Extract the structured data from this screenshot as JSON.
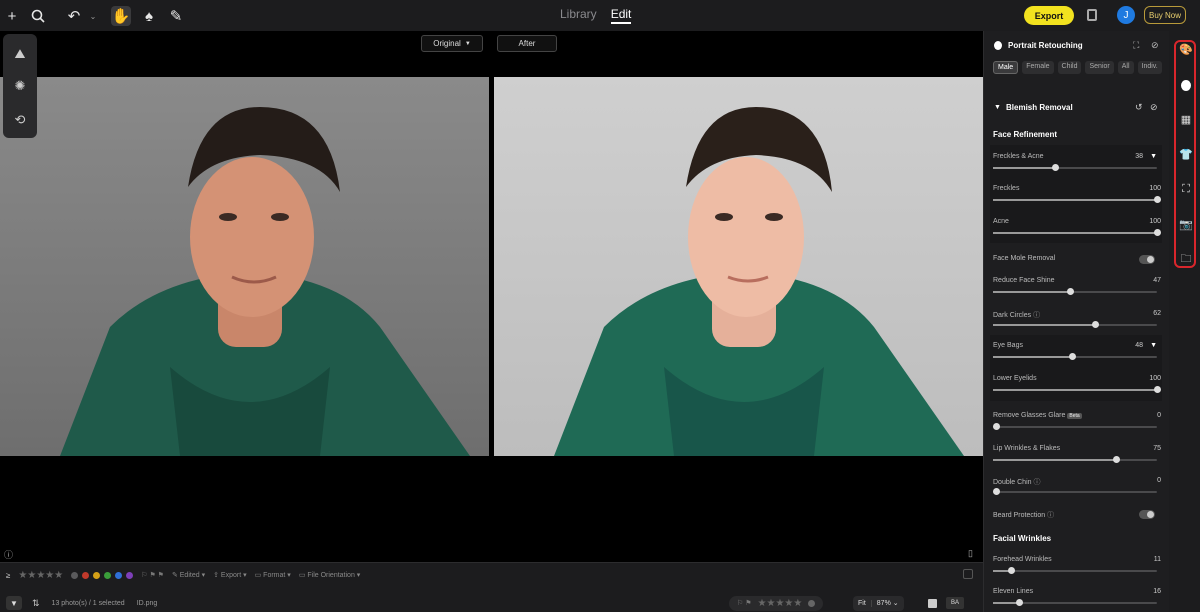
{
  "toolbar": {
    "modes": [
      "Library",
      "Edit"
    ],
    "active_mode": "Edit",
    "export_label": "Export",
    "avatar_initial": "J",
    "buy_label": "Buy Now"
  },
  "viewer": {
    "before_label": "Original",
    "after_label": "After"
  },
  "panel": {
    "title": "Portrait Retouching",
    "tags": [
      "Male",
      "Female",
      "Child",
      "Senior",
      "All",
      "Indiv."
    ],
    "active_tag": "Male",
    "group_title": "Blemish Removal",
    "section_face_refinement": "Face Refinement",
    "section_facial_wrinkles": "Facial Wrinkles",
    "sliders": [
      {
        "label": "Freckles & Acne",
        "value": "38"
      },
      {
        "label": "Freckles",
        "value": "100"
      },
      {
        "label": "Acne",
        "value": "100"
      },
      {
        "label": "Reduce Face Shine",
        "value": "47"
      },
      {
        "label": "Dark Circles",
        "value": "62"
      },
      {
        "label": "Eye Bags",
        "value": "48"
      },
      {
        "label": "Lower Eyelids",
        "value": "100"
      },
      {
        "label": "Remove Glasses Glare",
        "value": "0"
      },
      {
        "label": "Lip Wrinkles & Flakes",
        "value": "75"
      },
      {
        "label": "Double Chin",
        "value": "0"
      },
      {
        "label": "Forehead Wrinkles",
        "value": "11"
      },
      {
        "label": "Eleven Lines",
        "value": "16"
      }
    ],
    "toggles": [
      {
        "label": "Face Mole Removal"
      },
      {
        "label": "Beard Protection"
      }
    ],
    "beta_label": "Beta"
  },
  "bottom": {
    "filters": [
      "Edited",
      "Export",
      "Format",
      "File Orientation"
    ],
    "selection_text": "13 photo(s) / 1 selected",
    "filename": "ID.png",
    "fit_label": "Fit",
    "zoom": "87%",
    "color_labels": [
      "#5a5a5c",
      "#c0392b",
      "#d4a017",
      "#3a9d3a",
      "#2f6fd6",
      "#7d3fb8"
    ]
  }
}
